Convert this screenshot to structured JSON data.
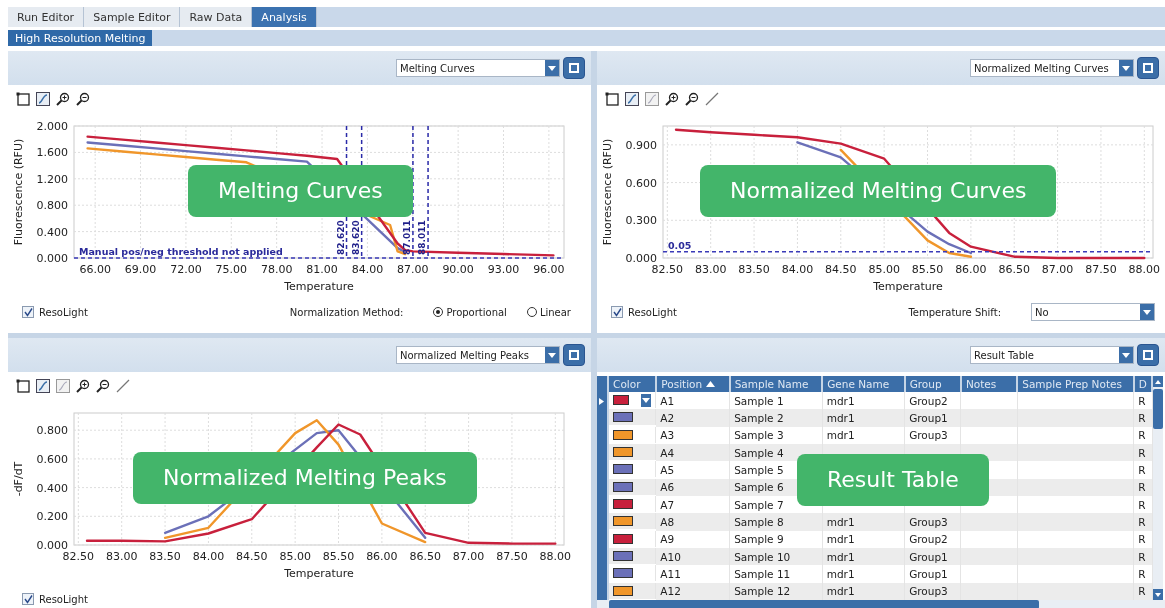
{
  "tabs": [
    {
      "label": "Run Editor",
      "selected": false
    },
    {
      "label": "Sample Editor",
      "selected": false
    },
    {
      "label": "Raw Data",
      "selected": false
    },
    {
      "label": "Analysis",
      "selected": true
    }
  ],
  "subtabs": [
    {
      "label": "High Resolution Melting",
      "selected": true
    }
  ],
  "panels": [
    {
      "kind": "chart",
      "view": "Melting Curves",
      "overlay": "Melting Curves",
      "tools": [
        {
          "kind": "select"
        },
        {
          "kind": "fit"
        },
        {
          "kind": "zoom-in"
        },
        {
          "kind": "zoom-out"
        }
      ],
      "chart_data": {
        "type": "line",
        "xlabel": "Temperature",
        "ylabel": "Fluorescence (RFU)",
        "xlim": [
          64.6,
          97
        ],
        "ylim": [
          0,
          2.0
        ],
        "grid": true,
        "x": [
          65.5,
          68,
          70,
          72,
          74,
          76,
          78,
          80,
          82,
          85.5,
          86,
          86.5,
          87,
          90,
          93,
          96.3
        ],
        "xticks": [
          {
            "value": 66,
            "label": "66.00"
          },
          {
            "value": 69,
            "label": "69.00"
          },
          {
            "value": 72,
            "label": "72.00"
          },
          {
            "value": 75,
            "label": "75.00"
          },
          {
            "value": 78,
            "label": "78.00"
          },
          {
            "value": 81,
            "label": "81.00"
          },
          {
            "value": 84,
            "label": "84.00"
          },
          {
            "value": 87,
            "label": "87.00"
          },
          {
            "value": 90,
            "label": "90.00"
          },
          {
            "value": 93,
            "label": "93.00"
          },
          {
            "value": 96,
            "label": "96.00"
          }
        ],
        "yticks": [
          {
            "value": 0,
            "label": "0.000"
          },
          {
            "value": 0.4,
            "label": "0.400"
          },
          {
            "value": 0.8,
            "label": "0.800"
          },
          {
            "value": 1.2,
            "label": "1.200"
          },
          {
            "value": 1.6,
            "label": "1.600"
          },
          {
            "value": 2.0,
            "label": "2.000"
          }
        ],
        "series": [
          {
            "color": "#6b70b8",
            "values": [
              1.75,
              1.7,
              1.66,
              1.62,
              1.58,
              1.54,
              1.5,
              1.46,
              null,
              null,
              0.15,
              0.09,
              null,
              null,
              null,
              null
            ]
          },
          {
            "color": "#f0962a",
            "values": [
              1.66,
              1.61,
              1.57,
              1.53,
              1.49,
              1.45,
              null,
              null,
              null,
              0.5,
              0.1,
              0.06,
              null,
              null,
              null,
              null
            ]
          },
          {
            "color": "#c8203c",
            "values": [
              1.84,
              1.79,
              1.75,
              1.71,
              1.67,
              1.63,
              1.59,
              1.55,
              1.5,
              null,
              0.22,
              0.12,
              0.1,
              0.08,
              0.06,
              0.04
            ]
          }
        ],
        "ref_lines": [
          {
            "axis": "x",
            "value": 82.62,
            "label": "82.620"
          },
          {
            "axis": "x",
            "value": 83.62,
            "label": "83.620"
          },
          {
            "axis": "x",
            "value": 87.011,
            "label": "87.011"
          },
          {
            "axis": "x",
            "value": 88.011,
            "label": "88.011"
          },
          {
            "axis": "y",
            "value": 0,
            "label": "Manual pos/neg threshold not applied"
          }
        ]
      },
      "resolight": {
        "label": "ResoLight",
        "checked": true
      },
      "normalization": {
        "label": "Normalization Method:",
        "options": [
          {
            "label": "Proportional",
            "selected": true
          },
          {
            "label": "Linear",
            "selected": false
          }
        ]
      }
    },
    {
      "kind": "chart",
      "view": "Normalized Melting Curves",
      "overlay": "Normalized Melting Curves",
      "tools": [
        {
          "kind": "select"
        },
        {
          "kind": "fit"
        },
        {
          "kind": "fit-off"
        },
        {
          "kind": "zoom-in"
        },
        {
          "kind": "zoom-out"
        },
        {
          "kind": "line"
        }
      ],
      "chart_data": {
        "type": "line",
        "xlabel": "Temperature",
        "ylabel": "Fluorescence (RFU)",
        "xlim": [
          82.45,
          88.1
        ],
        "ylim": [
          0,
          1.05
        ],
        "grid": true,
        "x": [
          82.6,
          83,
          83.5,
          84,
          84.5,
          85,
          85.5,
          85.75,
          86,
          86.5,
          87,
          87.5,
          88
        ],
        "xticks": [
          {
            "value": 82.5,
            "label": "82.50"
          },
          {
            "value": 83,
            "label": "83.00"
          },
          {
            "value": 83.5,
            "label": "83.50"
          },
          {
            "value": 84,
            "label": "84.00"
          },
          {
            "value": 84.5,
            "label": "84.50"
          },
          {
            "value": 85,
            "label": "85.00"
          },
          {
            "value": 85.5,
            "label": "85.50"
          },
          {
            "value": 86,
            "label": "86.00"
          },
          {
            "value": 86.5,
            "label": "86.50"
          },
          {
            "value": 87,
            "label": "87.00"
          },
          {
            "value": 87.5,
            "label": "87.50"
          },
          {
            "value": 88,
            "label": "88.00"
          }
        ],
        "yticks": [
          {
            "value": 0,
            "label": "0.000"
          },
          {
            "value": 0.3,
            "label": "0.300"
          },
          {
            "value": 0.6,
            "label": "0.600"
          },
          {
            "value": 0.9,
            "label": "0.900"
          }
        ],
        "series": [
          {
            "color": "#6b70b8",
            "values": [
              null,
              null,
              null,
              0.92,
              0.8,
              null,
              0.21,
              0.11,
              0.04,
              null,
              null,
              null,
              null
            ]
          },
          {
            "color": "#f0962a",
            "values": [
              null,
              null,
              null,
              null,
              0.86,
              null,
              0.14,
              0.04,
              0.01,
              null,
              null,
              null,
              null
            ]
          },
          {
            "color": "#c8203c",
            "values": [
              1.02,
              1.0,
              0.98,
              0.96,
              0.91,
              0.79,
              null,
              0.2,
              0.09,
              0.01,
              0.0,
              0.0,
              0.0
            ]
          }
        ],
        "ref_lines": [
          {
            "axis": "y",
            "value": 0.05,
            "label": "0.05"
          }
        ]
      },
      "resolight": {
        "label": "ResoLight",
        "checked": true
      },
      "temperature_shift": {
        "label": "Temperature Shift:",
        "value": "No"
      }
    },
    {
      "kind": "chart",
      "view": "Normalized Melting Peaks",
      "overlay": "Normalized Melting Peaks",
      "tools": [
        {
          "kind": "select"
        },
        {
          "kind": "fit"
        },
        {
          "kind": "fit-off"
        },
        {
          "kind": "zoom-in"
        },
        {
          "kind": "zoom-out"
        },
        {
          "kind": "line"
        }
      ],
      "chart_data": {
        "type": "line",
        "xlabel": "Temperature",
        "ylabel": "-dF/dT",
        "xlim": [
          82.45,
          88.1
        ],
        "ylim": [
          0,
          0.92
        ],
        "grid": true,
        "x": [
          82.6,
          83,
          83.5,
          84,
          84.5,
          85,
          85.25,
          85.5,
          85.75,
          86,
          86.5,
          87,
          87.5,
          88
        ],
        "xticks": [
          {
            "value": 82.5,
            "label": "82.50"
          },
          {
            "value": 83,
            "label": "83.00"
          },
          {
            "value": 83.5,
            "label": "83.50"
          },
          {
            "value": 84,
            "label": "84.00"
          },
          {
            "value": 84.5,
            "label": "84.50"
          },
          {
            "value": 85,
            "label": "85.00"
          },
          {
            "value": 85.5,
            "label": "85.50"
          },
          {
            "value": 86,
            "label": "86.00"
          },
          {
            "value": 86.5,
            "label": "86.50"
          },
          {
            "value": 87,
            "label": "87.00"
          },
          {
            "value": 87.5,
            "label": "87.50"
          },
          {
            "value": 88,
            "label": "88.00"
          }
        ],
        "yticks": [
          {
            "value": 0,
            "label": "0.000"
          },
          {
            "value": 0.2,
            "label": "0.200"
          },
          {
            "value": 0.4,
            "label": "0.400"
          },
          {
            "value": 0.6,
            "label": "0.600"
          },
          {
            "value": 0.8,
            "label": "0.800"
          }
        ],
        "series": [
          {
            "color": "#6b70b8",
            "values": [
              null,
              null,
              0.085,
              0.2,
              null,
              null,
              0.78,
              0.8,
              null,
              null,
              0.05,
              null,
              null,
              null
            ]
          },
          {
            "color": "#f0962a",
            "values": [
              null,
              null,
              0.05,
              0.12,
              null,
              0.78,
              0.87,
              0.7,
              null,
              0.15,
              0.02,
              null,
              null,
              null
            ]
          },
          {
            "color": "#c8203c",
            "values": [
              0.03,
              0.03,
              0.025,
              0.08,
              0.18,
              null,
              0.68,
              0.84,
              0.77,
              null,
              0.085,
              0.015,
              0.01,
              0.01
            ]
          }
        ]
      },
      "resolight": {
        "label": "ResoLight",
        "checked": true
      }
    },
    {
      "kind": "table",
      "view": "Result Table",
      "overlay": "Result Table",
      "table": {
        "columns": [
          {
            "label": "Color"
          },
          {
            "label": "Position",
            "sorted": true
          },
          {
            "label": "Sample Name"
          },
          {
            "label": "Gene Name"
          },
          {
            "label": "Group"
          },
          {
            "label": "Notes"
          },
          {
            "label": "Sample Prep Notes"
          },
          {
            "label": "D"
          }
        ],
        "rows": [
          {
            "selected": true,
            "color": "#c8203c",
            "position": "A1",
            "sample": "Sample 1",
            "gene": "mdr1",
            "group": "Group2",
            "column_8": "R"
          },
          {
            "selected": false,
            "color": "#6b70b8",
            "position": "A2",
            "sample": "Sample 2",
            "gene": "mdr1",
            "group": "Group1",
            "column_8": "R"
          },
          {
            "selected": false,
            "color": "#f0962a",
            "position": "A3",
            "sample": "Sample 3",
            "gene": "mdr1",
            "group": "Group3",
            "column_8": "R"
          },
          {
            "selected": false,
            "color": "#f0962a",
            "position": "A4",
            "sample": "Sample 4",
            "column_8": "R"
          },
          {
            "selected": false,
            "color": "#6b70b8",
            "position": "A5",
            "sample": "Sample 5",
            "column_8": "R"
          },
          {
            "selected": false,
            "color": "#6b70b8",
            "position": "A6",
            "sample": "Sample 6",
            "column_8": "R"
          },
          {
            "selected": false,
            "color": "#c8203c",
            "position": "A7",
            "sample": "Sample 7",
            "column_8": "R"
          },
          {
            "selected": false,
            "color": "#f0962a",
            "position": "A8",
            "sample": "Sample 8",
            "gene": "mdr1",
            "group": "Group3",
            "column_8": "R"
          },
          {
            "selected": false,
            "color": "#c8203c",
            "position": "A9",
            "sample": "Sample 9",
            "gene": "mdr1",
            "group": "Group2",
            "column_8": "R"
          },
          {
            "selected": false,
            "color": "#6b70b8",
            "position": "A10",
            "sample": "Sample 10",
            "gene": "mdr1",
            "group": "Group1",
            "column_8": "R"
          },
          {
            "selected": false,
            "color": "#6b70b8",
            "position": "A11",
            "sample": "Sample 11",
            "gene": "mdr1",
            "group": "Group1",
            "column_8": "R"
          },
          {
            "selected": false,
            "color": "#f0962a",
            "position": "A12",
            "sample": "Sample 12",
            "gene": "mdr1",
            "group": "Group3",
            "column_8": "R"
          }
        ]
      }
    }
  ]
}
